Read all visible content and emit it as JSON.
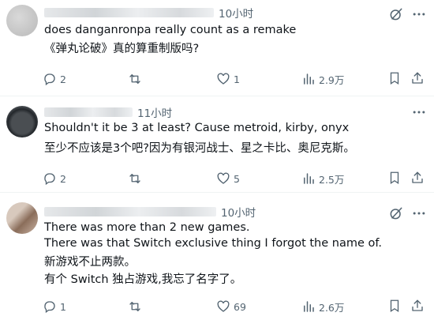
{
  "replies": [
    {
      "time": "10小时",
      "text_en": "does danganronpa really count as a remake",
      "text_zh": "《弹丸论破》真的算重制版吗?",
      "replies_count": "2",
      "likes": "1",
      "views": "2.9万"
    },
    {
      "time": "11小时",
      "text_en": "Shouldn't it be 3 at least? Cause metroid, kirby, onyx",
      "text_zh": "至少不应该是3个吧?因为有银河战士、星之卡比、奥尼克斯。",
      "replies_count": "2",
      "likes": "5",
      "views": "2.5万"
    },
    {
      "time": "10小时",
      "text_en_1": "There was more than 2 new games.",
      "text_en_2": "There was that Switch exclusive thing I forgot the name of.",
      "text_zh_1": "新游戏不止两款。",
      "text_zh_2": "有个 Switch 独占游戏,我忘了名字了。",
      "replies_count": "1",
      "likes": "69",
      "views": "2.6万"
    }
  ],
  "icons": {
    "reply": "reply-icon",
    "repost": "repost-icon",
    "like": "heart-icon",
    "views": "views-icon",
    "bookmark": "bookmark-icon",
    "share": "share-icon",
    "grok": "grok-icon",
    "more": "more-icon"
  }
}
